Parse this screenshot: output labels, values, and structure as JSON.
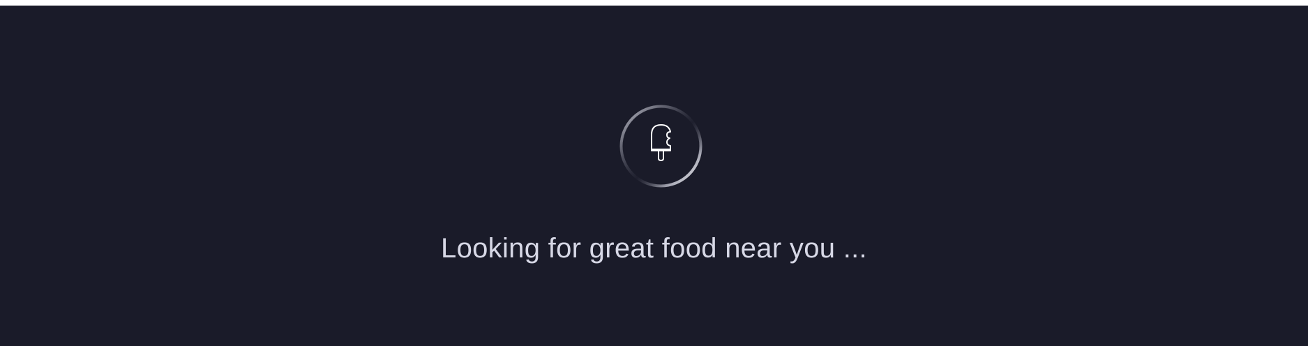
{
  "loading": {
    "message": "Looking for great food near you ...",
    "icon": "popsicle-icon",
    "spinner": "loading-spinner"
  },
  "colors": {
    "background": "#1a1b29",
    "text": "#d7d8e6",
    "spinner_ring": "#e5e6ee",
    "icon_stroke": "#ffffff"
  }
}
